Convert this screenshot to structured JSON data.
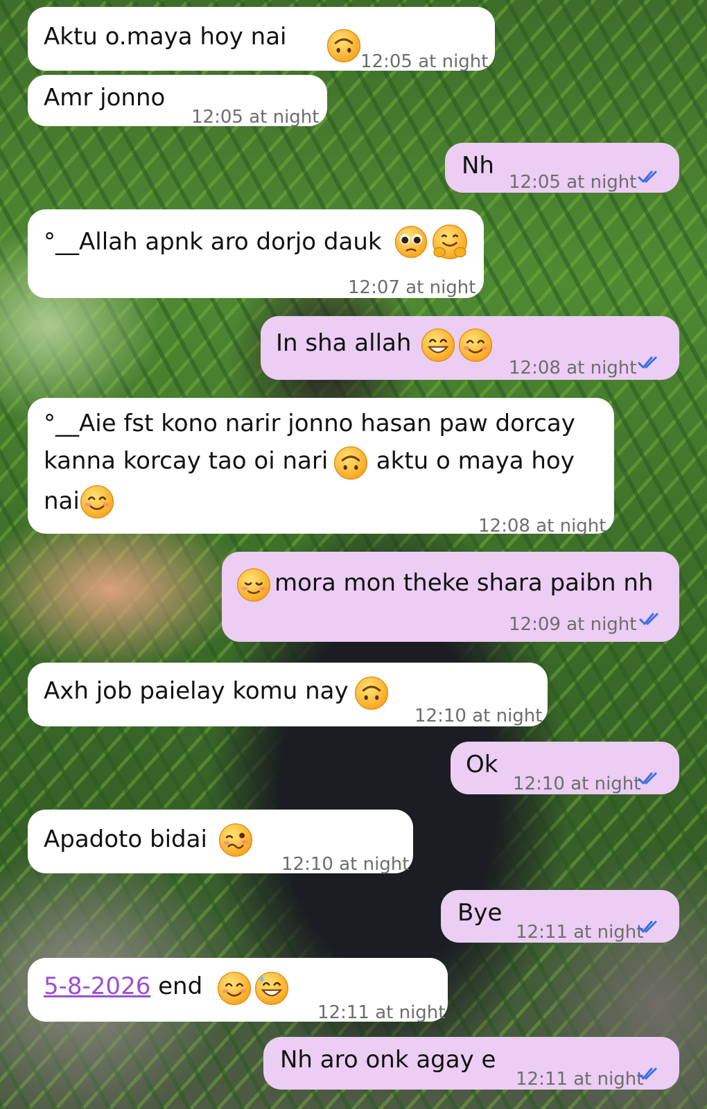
{
  "messages": [
    {
      "direction": "incoming",
      "text": "Aktu o.maya hoy nai",
      "emoji": [
        "upside-down-face"
      ],
      "time": "12:05 at night"
    },
    {
      "direction": "incoming",
      "text": "Amr jonno",
      "time": "12:05 at night"
    },
    {
      "direction": "outgoing",
      "text": "Nh",
      "time": "12:05 at night",
      "status": "read"
    },
    {
      "direction": "incoming",
      "text": "°__Allah apnk aro dorjo dauk",
      "emoji": [
        "pleading-face",
        "hugging-face"
      ],
      "time": "12:07 at night"
    },
    {
      "direction": "outgoing",
      "text": "In sha allah",
      "emoji": [
        "grinning-face",
        "smiling-face"
      ],
      "time": "12:08 at night",
      "status": "read"
    },
    {
      "direction": "incoming",
      "line1": "°__Aie fst kono narir jonno hasan paw dorcay",
      "line2a": "kanna korcay tao oi nari",
      "line2b": " aktu o maya hoy",
      "line3": "nai",
      "emoji": [
        "upside-down-face",
        "smiling-face"
      ],
      "time": "12:08 at night"
    },
    {
      "direction": "outgoing",
      "text": "mora mon theke shara paibn nh",
      "emoji": [
        "relieved-face"
      ],
      "time": "12:09 at night",
      "status": "read"
    },
    {
      "direction": "incoming",
      "text": "Axh job paielay komu nay",
      "emoji": [
        "upside-down-face"
      ],
      "time": "12:10 at night"
    },
    {
      "direction": "outgoing",
      "text": "Ok",
      "time": "12:10 at night",
      "status": "read"
    },
    {
      "direction": "incoming",
      "text": "Apadoto bidai",
      "emoji": [
        "woozy-face"
      ],
      "time": "12:10 at night"
    },
    {
      "direction": "outgoing",
      "text": "Bye",
      "time": "12:11 at night",
      "status": "read"
    },
    {
      "direction": "incoming",
      "date_link": "5-8-2026",
      "text": " end",
      "emoji": [
        "smiling-face",
        "grinning-sweat-face"
      ],
      "time": "12:11 at night"
    },
    {
      "direction": "outgoing",
      "text": "Nh aro onk agay e",
      "time": "12:11 at night",
      "status": "read"
    }
  ],
  "colors": {
    "incoming_bubble": "#ffffff",
    "outgoing_bubble": "#eccdf4",
    "read_ticks": "#3b6fe0",
    "link": "#9b4fd1"
  }
}
